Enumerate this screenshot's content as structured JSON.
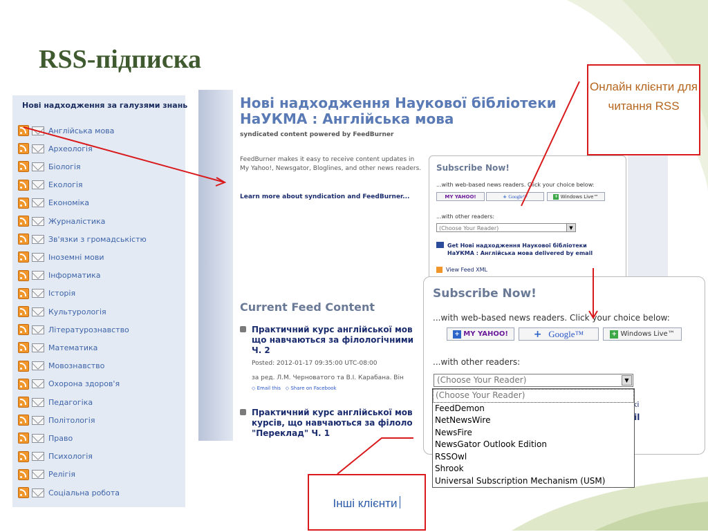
{
  "slide": {
    "title": "RSS-підписка"
  },
  "colors": {
    "accent_green": "#3f5a2e",
    "callout_border": "#d9191b",
    "link_blue": "#3d63a8",
    "heading_blue": "#5a7ab6"
  },
  "left_panel": {
    "heading": "Нові надходження за галузями знань",
    "items": [
      {
        "label": "Англійська мова"
      },
      {
        "label": "Археологія"
      },
      {
        "label": "Біологія"
      },
      {
        "label": "Екологія"
      },
      {
        "label": "Економіка"
      },
      {
        "label": "Журналістика"
      },
      {
        "label": "Зв'язки з громадськістю"
      },
      {
        "label": "Іноземні мови"
      },
      {
        "label": "Інформатика"
      },
      {
        "label": "Історія"
      },
      {
        "label": "Культурологія"
      },
      {
        "label": "Літературознавство"
      },
      {
        "label": "Математика"
      },
      {
        "label": "Мовознавство"
      },
      {
        "label": "Охорона здоров'я"
      },
      {
        "label": "Педагогіка"
      },
      {
        "label": "Політологія"
      },
      {
        "label": "Право"
      },
      {
        "label": "Психологія"
      },
      {
        "label": "Релігія"
      },
      {
        "label": "Соціальна робота"
      }
    ],
    "icons": [
      "rss-icon",
      "email-icon"
    ]
  },
  "web_page": {
    "title": "Нові надходження Наукової бібліотеки НаУКМА : Англійська мова",
    "subtitle": "syndicated content powered by FeedBurner",
    "description": "FeedBurner makes it easy to receive content updates in My Yahoo!, Newsgator, Bloglines, and other news readers.",
    "learn_more": "Learn more about syndication and FeedBurner...",
    "subscribe": {
      "title": "Subscribe Now!",
      "web_readers_text": "...with web-based news readers. Click your choice below:",
      "other_readers_text": "...with other readers:",
      "select_value": "(Choose Your Reader)",
      "email_text": "Get Нові надходження Наукової бібліотеки НаУКМА : Англійська мова delivered by email",
      "view_xml": "View Feed XML"
    },
    "current_feed_heading": "Current Feed Content",
    "posts": [
      {
        "title": "Практичний курс англійської мов що навчаються за філологічними Ч. 2",
        "posted": "Posted: 2012-01-17 09:35:00 UTC-08:00",
        "byline": "за ред. Л.М. Черноватого та В.І. Карабана. Він",
        "email_link": "Email this",
        "share_link": "Share on Facebook"
      },
      {
        "title": "Практичний курс англійської мов курсів, що навчаються за філоло \"Переклад\" Ч. 1"
      }
    ]
  },
  "readers": {
    "my_yahoo": "MY YAHOO!",
    "google": "Google™",
    "windows_live": "Windows Live™"
  },
  "subscribe_zoom": {
    "title": "Subscribe Now!",
    "web_readers_text": "...with web-based news readers. Click your choice below:",
    "other_readers_text": "...with other readers:",
    "select_value": "(Choose Your Reader)",
    "peek_text_1": "ki",
    "peek_text_2": "ail",
    "options": [
      "(Choose Your Reader)",
      "FeedDemon",
      "NetNewsWire",
      "NewsFire",
      "NewsGator Outlook Edition",
      "RSSOwl",
      "Shrook",
      "Universal Subscription Mechanism (USM)"
    ]
  },
  "callouts": {
    "online_clients": "Онлайн клієнти для читання RSS",
    "other_clients": "Інші клієнти"
  }
}
